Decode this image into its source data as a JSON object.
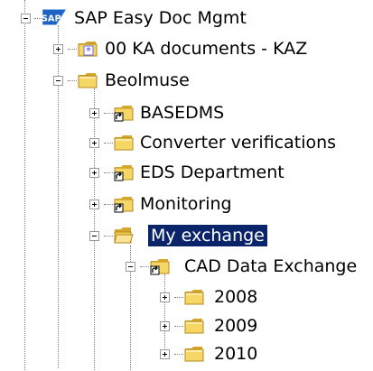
{
  "tree": {
    "root": {
      "label": "SAP Easy Doc Mgmt",
      "icon": "sap-logo-icon",
      "expanded": true
    },
    "nodes": [
      {
        "label": "00 KA documents - KAZ",
        "icon": "favorite-folder-icon",
        "expanded": false,
        "level": 1
      },
      {
        "label": "Beolmuse",
        "icon": "folder-icon",
        "expanded": true,
        "level": 1
      },
      {
        "label": "BASEDMS",
        "icon": "shortcut-folder-icon",
        "expanded": false,
        "level": 2
      },
      {
        "label": "Converter verifications",
        "icon": "folder-icon",
        "expanded": false,
        "level": 2
      },
      {
        "label": "EDS Department",
        "icon": "shortcut-folder-icon",
        "expanded": false,
        "level": 2
      },
      {
        "label": "Monitoring",
        "icon": "shortcut-folder-icon",
        "expanded": false,
        "level": 2
      },
      {
        "label": "My exchange",
        "icon": "open-folder-icon",
        "expanded": true,
        "level": 2,
        "selected": true
      },
      {
        "label": "CAD Data Exchange",
        "icon": "shortcut-folder-icon",
        "expanded": true,
        "level": 3
      },
      {
        "label": "2008",
        "icon": "folder-icon",
        "expanded": false,
        "level": 4
      },
      {
        "label": "2009",
        "icon": "folder-icon",
        "expanded": false,
        "level": 4
      },
      {
        "label": "2010",
        "icon": "folder-icon",
        "expanded": false,
        "level": 4
      }
    ]
  },
  "colors": {
    "selection_bg": "#0a246a",
    "selection_fg": "#ffffff",
    "folder_yellow": "#f6d766",
    "connector": "#808080"
  }
}
